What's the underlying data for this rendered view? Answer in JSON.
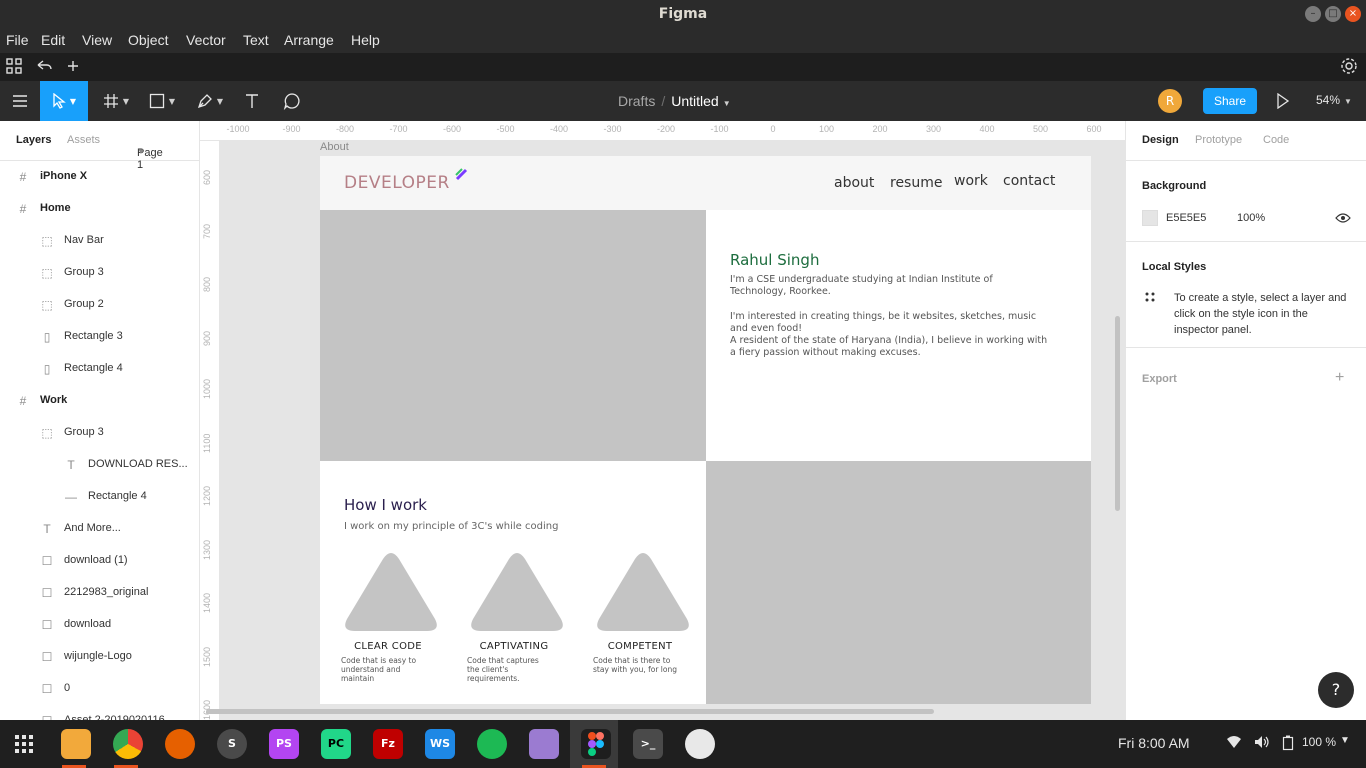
{
  "window": {
    "title": "Figma"
  },
  "menu": [
    "File",
    "Edit",
    "View",
    "Object",
    "Vector",
    "Text",
    "Arrange",
    "Help"
  ],
  "breadcrumb": {
    "drafts": "Drafts",
    "separator": "/",
    "file": "Untitled"
  },
  "toolbar": {
    "avatar_initial": "R",
    "share_label": "Share",
    "zoom": "54%"
  },
  "left_panel": {
    "tabs": [
      "Layers",
      "Assets"
    ],
    "page": "Page 1",
    "layers": [
      {
        "name": "iPhone X",
        "icon": "frame-icon",
        "kind": "frame"
      },
      {
        "name": "Home",
        "icon": "frame-icon",
        "kind": "frame"
      },
      {
        "name": "Nav Bar",
        "icon": "group-icon",
        "kind": "child"
      },
      {
        "name": "Group 3",
        "icon": "group-icon",
        "kind": "child"
      },
      {
        "name": "Group 2",
        "icon": "group-icon",
        "kind": "child"
      },
      {
        "name": "Rectangle 3",
        "icon": "rectangle-icon",
        "kind": "child"
      },
      {
        "name": "Rectangle 4",
        "icon": "rectangle-icon",
        "kind": "child"
      },
      {
        "name": "Work",
        "icon": "frame-icon",
        "kind": "frame"
      },
      {
        "name": "Group 3",
        "icon": "group-icon",
        "kind": "child"
      },
      {
        "name": "DOWNLOAD RES...",
        "icon": "text-icon",
        "kind": "grandchild"
      },
      {
        "name": "Rectangle 4",
        "icon": "line-icon",
        "kind": "grandchild"
      },
      {
        "name": "And More...",
        "icon": "text-icon",
        "kind": "child"
      },
      {
        "name": "download (1)",
        "icon": "image-icon",
        "kind": "child"
      },
      {
        "name": "2212983_original",
        "icon": "image-icon",
        "kind": "child"
      },
      {
        "name": "download",
        "icon": "image-icon",
        "kind": "child"
      },
      {
        "name": "wijungle-Logo",
        "icon": "image-icon",
        "kind": "child"
      },
      {
        "name": "0",
        "icon": "image-icon",
        "kind": "child"
      },
      {
        "name": "Asset 2-2019020116...",
        "icon": "image-icon",
        "kind": "child"
      }
    ]
  },
  "rulers": {
    "top": [
      "-1000",
      "-900",
      "-800",
      "-700",
      "-600",
      "-500",
      "-400",
      "-300",
      "-200",
      "-100",
      "0",
      "100",
      "200",
      "300",
      "400",
      "500",
      "600"
    ],
    "left": [
      "600",
      "700",
      "800",
      "900",
      "1000",
      "1100",
      "1200",
      "1300",
      "1400",
      "1500",
      "1600"
    ]
  },
  "canvas": {
    "frame_label": "About",
    "logo": "DEVELOPER",
    "nav": [
      "about",
      "resume",
      "work",
      "contact"
    ],
    "name": "Rahul Singh",
    "bio": [
      "I'm a CSE undergraduate studying at Indian Institute of Technology, Roorkee.",
      "I'm interested in creating things, be it websites, sketches, music and even food!",
      "A resident of the state of Haryana (India), I believe in working with a fiery passion without making excuses."
    ],
    "how_title": "How I work",
    "how_sub": "I work on my principle of 3C's while coding",
    "cards": [
      {
        "title": "CLEAR CODE",
        "desc": "Code that is easy to understand and maintain"
      },
      {
        "title": "CAPTIVATING",
        "desc": "Code that captures the client's requirements."
      },
      {
        "title": "COMPETENT",
        "desc": "Code that is there to stay with you, for long"
      }
    ],
    "colors": {
      "logo": "#b57f86",
      "name": "#1d6d3e",
      "heading": "#2a1f4d",
      "placeholder": "#c4c4c4"
    }
  },
  "right_panel": {
    "tabs": [
      "Design",
      "Prototype",
      "Code"
    ],
    "background_title": "Background",
    "bg_hex": "E5E5E5",
    "bg_opacity": "100%",
    "local_styles_title": "Local Styles",
    "local_styles_hint": "To create a style, select a layer and click on the style icon in the inspector panel.",
    "export_title": "Export"
  },
  "help_label": "?",
  "taskbar": {
    "clock": "Fri  8:00 AM",
    "battery": "100 %",
    "apps": [
      {
        "name": "app-grid-icon",
        "label": ""
      },
      {
        "name": "files-icon",
        "label": ""
      },
      {
        "name": "chrome-icon",
        "label": ""
      },
      {
        "name": "firefox-icon",
        "label": ""
      },
      {
        "name": "sublime-icon",
        "label": "S"
      },
      {
        "name": "phpstorm-icon",
        "label": "PS"
      },
      {
        "name": "pycharm-icon",
        "label": "PC"
      },
      {
        "name": "filezilla-icon",
        "label": "Fz"
      },
      {
        "name": "webstorm-icon",
        "label": "WS"
      },
      {
        "name": "spotify-icon",
        "label": ""
      },
      {
        "name": "text-editor-icon",
        "label": ""
      },
      {
        "name": "figma-icon",
        "label": ""
      },
      {
        "name": "terminal-icon",
        "label": ">_"
      },
      {
        "name": "signature-app-icon",
        "label": ""
      }
    ]
  }
}
